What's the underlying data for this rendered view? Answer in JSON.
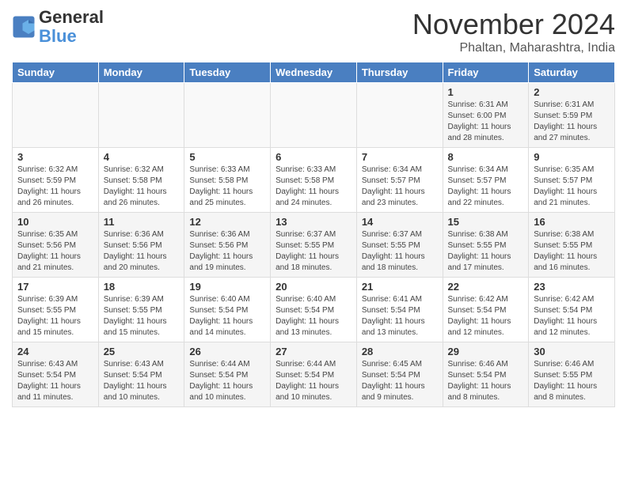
{
  "header": {
    "logo_line1": "General",
    "logo_line2": "Blue",
    "month": "November 2024",
    "location": "Phaltan, Maharashtra, India"
  },
  "days_of_week": [
    "Sunday",
    "Monday",
    "Tuesday",
    "Wednesday",
    "Thursday",
    "Friday",
    "Saturday"
  ],
  "weeks": [
    [
      {
        "day": "",
        "info": ""
      },
      {
        "day": "",
        "info": ""
      },
      {
        "day": "",
        "info": ""
      },
      {
        "day": "",
        "info": ""
      },
      {
        "day": "",
        "info": ""
      },
      {
        "day": "1",
        "info": "Sunrise: 6:31 AM\nSunset: 6:00 PM\nDaylight: 11 hours and 28 minutes."
      },
      {
        "day": "2",
        "info": "Sunrise: 6:31 AM\nSunset: 5:59 PM\nDaylight: 11 hours and 27 minutes."
      }
    ],
    [
      {
        "day": "3",
        "info": "Sunrise: 6:32 AM\nSunset: 5:59 PM\nDaylight: 11 hours and 26 minutes."
      },
      {
        "day": "4",
        "info": "Sunrise: 6:32 AM\nSunset: 5:58 PM\nDaylight: 11 hours and 26 minutes."
      },
      {
        "day": "5",
        "info": "Sunrise: 6:33 AM\nSunset: 5:58 PM\nDaylight: 11 hours and 25 minutes."
      },
      {
        "day": "6",
        "info": "Sunrise: 6:33 AM\nSunset: 5:58 PM\nDaylight: 11 hours and 24 minutes."
      },
      {
        "day": "7",
        "info": "Sunrise: 6:34 AM\nSunset: 5:57 PM\nDaylight: 11 hours and 23 minutes."
      },
      {
        "day": "8",
        "info": "Sunrise: 6:34 AM\nSunset: 5:57 PM\nDaylight: 11 hours and 22 minutes."
      },
      {
        "day": "9",
        "info": "Sunrise: 6:35 AM\nSunset: 5:57 PM\nDaylight: 11 hours and 21 minutes."
      }
    ],
    [
      {
        "day": "10",
        "info": "Sunrise: 6:35 AM\nSunset: 5:56 PM\nDaylight: 11 hours and 21 minutes."
      },
      {
        "day": "11",
        "info": "Sunrise: 6:36 AM\nSunset: 5:56 PM\nDaylight: 11 hours and 20 minutes."
      },
      {
        "day": "12",
        "info": "Sunrise: 6:36 AM\nSunset: 5:56 PM\nDaylight: 11 hours and 19 minutes."
      },
      {
        "day": "13",
        "info": "Sunrise: 6:37 AM\nSunset: 5:55 PM\nDaylight: 11 hours and 18 minutes."
      },
      {
        "day": "14",
        "info": "Sunrise: 6:37 AM\nSunset: 5:55 PM\nDaylight: 11 hours and 18 minutes."
      },
      {
        "day": "15",
        "info": "Sunrise: 6:38 AM\nSunset: 5:55 PM\nDaylight: 11 hours and 17 minutes."
      },
      {
        "day": "16",
        "info": "Sunrise: 6:38 AM\nSunset: 5:55 PM\nDaylight: 11 hours and 16 minutes."
      }
    ],
    [
      {
        "day": "17",
        "info": "Sunrise: 6:39 AM\nSunset: 5:55 PM\nDaylight: 11 hours and 15 minutes."
      },
      {
        "day": "18",
        "info": "Sunrise: 6:39 AM\nSunset: 5:55 PM\nDaylight: 11 hours and 15 minutes."
      },
      {
        "day": "19",
        "info": "Sunrise: 6:40 AM\nSunset: 5:54 PM\nDaylight: 11 hours and 14 minutes."
      },
      {
        "day": "20",
        "info": "Sunrise: 6:40 AM\nSunset: 5:54 PM\nDaylight: 11 hours and 13 minutes."
      },
      {
        "day": "21",
        "info": "Sunrise: 6:41 AM\nSunset: 5:54 PM\nDaylight: 11 hours and 13 minutes."
      },
      {
        "day": "22",
        "info": "Sunrise: 6:42 AM\nSunset: 5:54 PM\nDaylight: 11 hours and 12 minutes."
      },
      {
        "day": "23",
        "info": "Sunrise: 6:42 AM\nSunset: 5:54 PM\nDaylight: 11 hours and 12 minutes."
      }
    ],
    [
      {
        "day": "24",
        "info": "Sunrise: 6:43 AM\nSunset: 5:54 PM\nDaylight: 11 hours and 11 minutes."
      },
      {
        "day": "25",
        "info": "Sunrise: 6:43 AM\nSunset: 5:54 PM\nDaylight: 11 hours and 10 minutes."
      },
      {
        "day": "26",
        "info": "Sunrise: 6:44 AM\nSunset: 5:54 PM\nDaylight: 11 hours and 10 minutes."
      },
      {
        "day": "27",
        "info": "Sunrise: 6:44 AM\nSunset: 5:54 PM\nDaylight: 11 hours and 10 minutes."
      },
      {
        "day": "28",
        "info": "Sunrise: 6:45 AM\nSunset: 5:54 PM\nDaylight: 11 hours and 9 minutes."
      },
      {
        "day": "29",
        "info": "Sunrise: 6:46 AM\nSunset: 5:54 PM\nDaylight: 11 hours and 8 minutes."
      },
      {
        "day": "30",
        "info": "Sunrise: 6:46 AM\nSunset: 5:55 PM\nDaylight: 11 hours and 8 minutes."
      }
    ]
  ]
}
